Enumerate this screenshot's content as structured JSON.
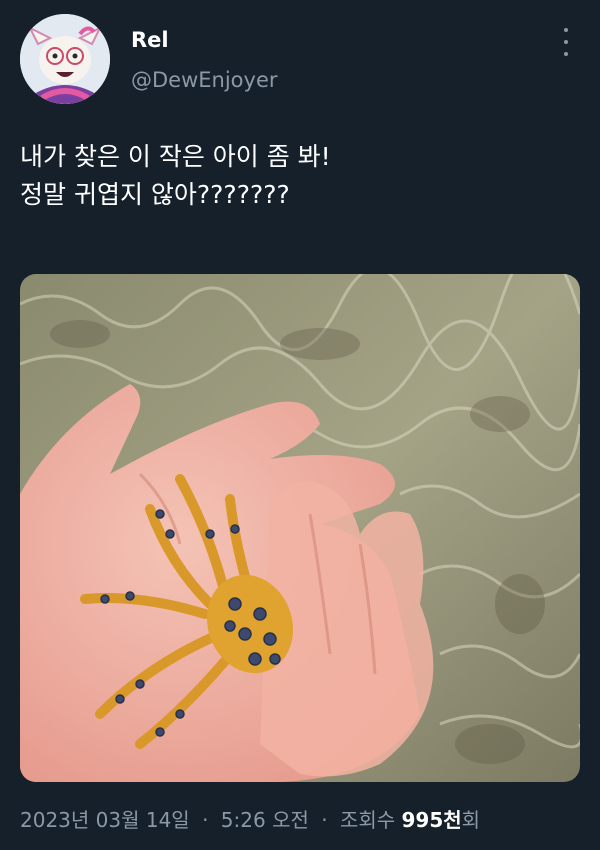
{
  "author": {
    "name": "Rel",
    "handle": "@DewEnjoyer"
  },
  "tweet": {
    "lines": [
      "내가 찾은 이 작은 아이 좀 봐!",
      "정말 귀엽지 않아???????"
    ]
  },
  "meta": {
    "date": "2023년 03월 14일",
    "separator": "·",
    "time": "5:26 오전",
    "views_label": "조회수",
    "views_count": "995천",
    "views_suffix": "회"
  },
  "colors": {
    "background": "#15202b",
    "secondary_text": "#8b98a5",
    "primary_text": "#ffffff"
  },
  "icons": {
    "more": "more-vertical-icon"
  }
}
